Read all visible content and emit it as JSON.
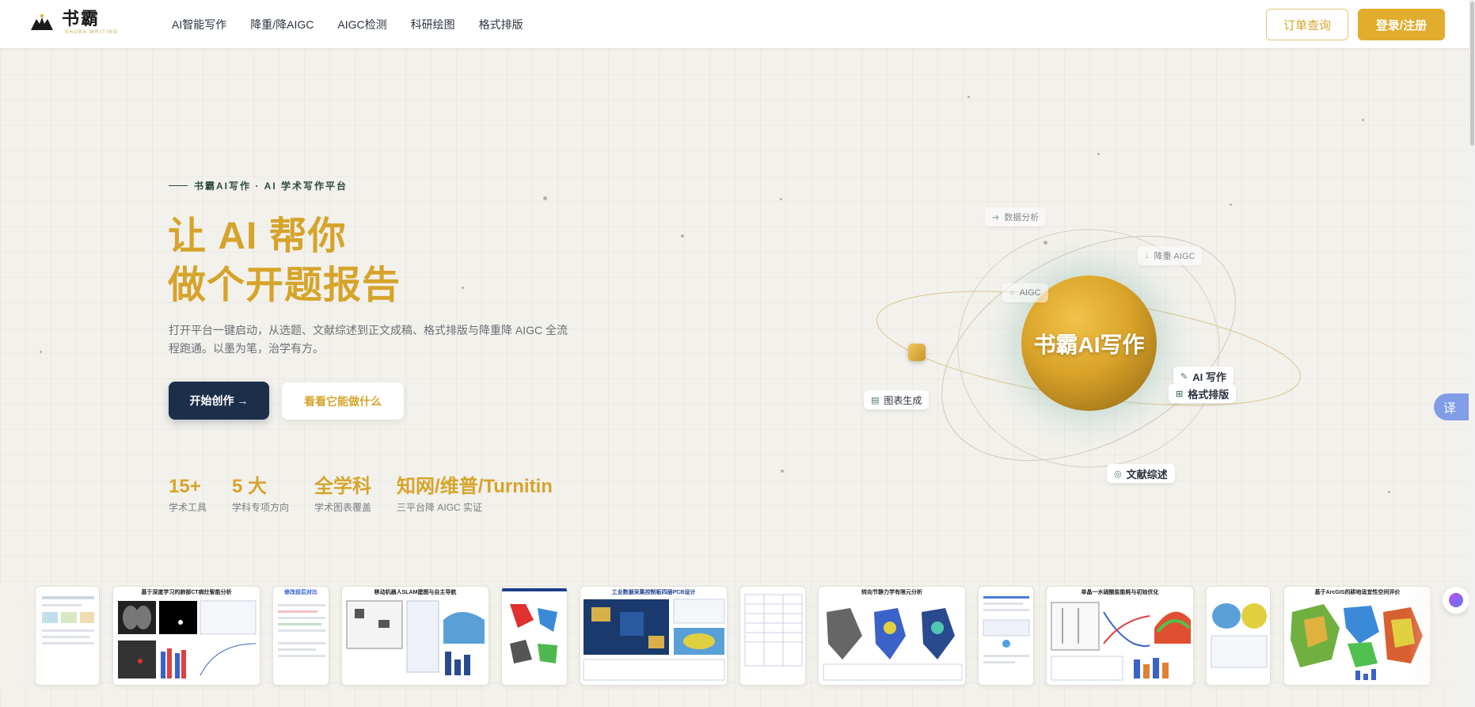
{
  "brand": {
    "name": "书霸",
    "subtitle": "SHUBA WRITING"
  },
  "nav": {
    "items": [
      {
        "label": "AI智能写作"
      },
      {
        "label": "降重/降AIGC"
      },
      {
        "label": "AIGC检测"
      },
      {
        "label": "科研绘图"
      },
      {
        "label": "格式排版"
      }
    ]
  },
  "header": {
    "order_label": "订单查询",
    "login_label": "登录/注册"
  },
  "hero": {
    "eyebrow": "书霸AI写作 · AI 学术写作平台",
    "headline_line1": "让 AI 帮你",
    "headline_line2": "做个开题报告",
    "description": "打开平台一键启动，从选题、文献综述到正文成稿、格式排版与降重降 AIGC 全流程跑通。以墨为笔，治学有方。",
    "primary_cta": "开始创作 →",
    "secondary_cta": "看看它能做什么"
  },
  "stats": [
    {
      "value": "15+",
      "label": "学术工具"
    },
    {
      "value": "5 大",
      "label": "学科专项方向"
    },
    {
      "value": "全学科",
      "label": "学术图表覆盖"
    },
    {
      "value": "知网/维普/Turnitin",
      "label": "三平台降 AIGC 实证"
    }
  ],
  "orbit": {
    "center_label": "书霸AI写作",
    "tags": {
      "data_analysis": "数据分析",
      "reduce_aigc": "降重 AIGC",
      "aigc": "AIGC",
      "ai_writing": "AI 写作",
      "format": "格式排版",
      "chart_gen": "图表生成",
      "literature": "文献综述"
    }
  },
  "floating": {
    "translate_label": "译"
  },
  "gallery": {
    "titles": [
      "",
      "基于深度学习的肺部CT病灶智能分析",
      "修改前后对比",
      "移动机器人SLAM建图与自主导航",
      "",
      "工业数据采集控制板四层PCB设计",
      "",
      "转向节静力学有限元分析",
      "",
      "单晶一水硫酸盐能耗与初始优化",
      "",
      "基于ArcGIS的耕地适宜性空间评价"
    ]
  },
  "colors": {
    "accent": "#d6a42b",
    "navy": "#1c2f4a",
    "background": "#f3f1ec"
  }
}
